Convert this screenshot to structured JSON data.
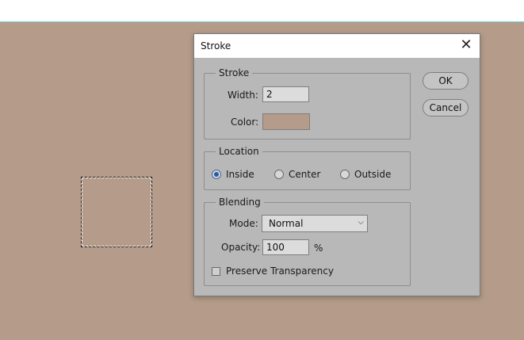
{
  "canvas": {
    "bg_color": "#b59b89"
  },
  "dialog": {
    "title": "Stroke",
    "close_icon": "close-icon",
    "stroke_group": {
      "legend": "Stroke",
      "width_label": "Width:",
      "width_value": "2",
      "color_label": "Color:",
      "color_value": "#b59b89"
    },
    "location_group": {
      "legend": "Location",
      "options": [
        {
          "label": "Inside",
          "checked": true
        },
        {
          "label": "Center",
          "checked": false
        },
        {
          "label": "Outside",
          "checked": false
        }
      ]
    },
    "blending_group": {
      "legend": "Blending",
      "mode_label": "Mode:",
      "mode_value": "Normal",
      "opacity_label": "Opacity:",
      "opacity_value": "100",
      "opacity_unit": "%",
      "preserve_label": "Preserve Transparency",
      "preserve_checked": false
    },
    "ok_label": "OK",
    "cancel_label": "Cancel"
  }
}
